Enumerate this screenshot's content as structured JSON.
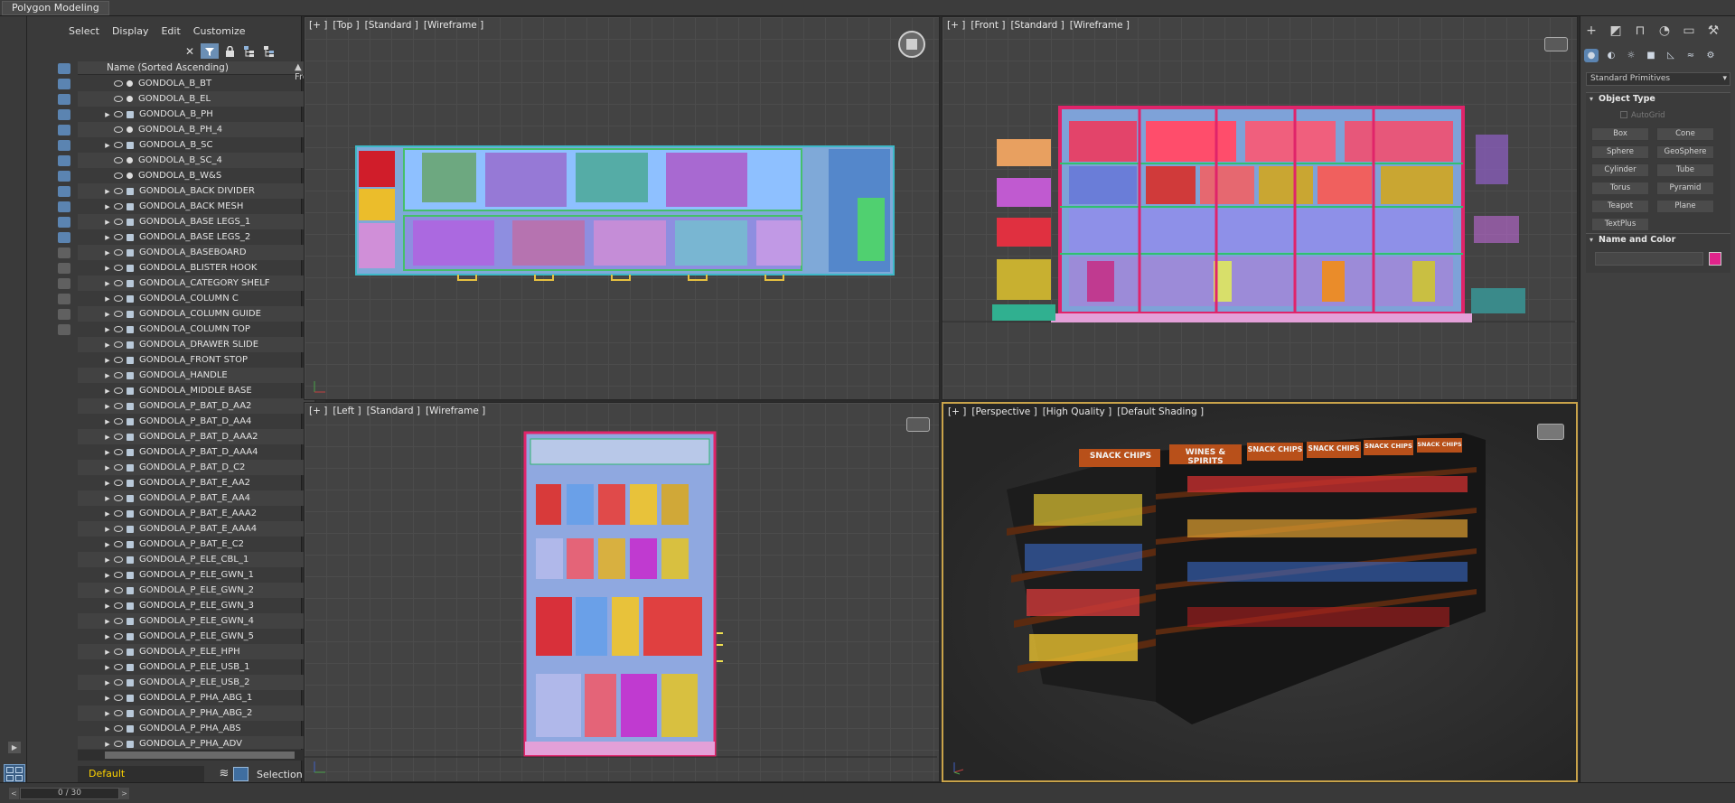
{
  "ribbon": {
    "tab": "Polygon Modeling"
  },
  "explorer": {
    "menu": [
      "Select",
      "Display",
      "Edit",
      "Customize"
    ],
    "columns": {
      "name": "Name (Sorted Ascending)",
      "frozen": "▲ Fro..."
    },
    "rows": [
      {
        "name": "GONDOLA_B_BT",
        "group": false
      },
      {
        "name": "GONDOLA_B_EL",
        "group": false
      },
      {
        "name": "GONDOLA_B_PH",
        "group": true
      },
      {
        "name": "GONDOLA_B_PH_4",
        "group": false
      },
      {
        "name": "GONDOLA_B_SC",
        "group": true
      },
      {
        "name": "GONDOLA_B_SC_4",
        "group": false
      },
      {
        "name": "GONDOLA_B_W&S",
        "group": false
      },
      {
        "name": "GONDOLA_BACK DIVIDER",
        "group": true
      },
      {
        "name": "GONDOLA_BACK MESH",
        "group": true
      },
      {
        "name": "GONDOLA_BASE LEGS_1",
        "group": true
      },
      {
        "name": "GONDOLA_BASE LEGS_2",
        "group": true
      },
      {
        "name": "GONDOLA_BASEBOARD",
        "group": true
      },
      {
        "name": "GONDOLA_BLISTER HOOK",
        "group": true
      },
      {
        "name": "GONDOLA_CATEGORY SHELF",
        "group": true
      },
      {
        "name": "GONDOLA_COLUMN C",
        "group": true
      },
      {
        "name": "GONDOLA_COLUMN GUIDE",
        "group": true
      },
      {
        "name": "GONDOLA_COLUMN TOP",
        "group": true
      },
      {
        "name": "GONDOLA_DRAWER SLIDE",
        "group": true
      },
      {
        "name": "GONDOLA_FRONT STOP",
        "group": true
      },
      {
        "name": "GONDOLA_HANDLE",
        "group": true
      },
      {
        "name": "GONDOLA_MIDDLE BASE",
        "group": true
      },
      {
        "name": "GONDOLA_P_BAT_D_AA2",
        "group": true
      },
      {
        "name": "GONDOLA_P_BAT_D_AA4",
        "group": true
      },
      {
        "name": "GONDOLA_P_BAT_D_AAA2",
        "group": true
      },
      {
        "name": "GONDOLA_P_BAT_D_AAA4",
        "group": true
      },
      {
        "name": "GONDOLA_P_BAT_D_C2",
        "group": true
      },
      {
        "name": "GONDOLA_P_BAT_E_AA2",
        "group": true
      },
      {
        "name": "GONDOLA_P_BAT_E_AA4",
        "group": true
      },
      {
        "name": "GONDOLA_P_BAT_E_AAA2",
        "group": true
      },
      {
        "name": "GONDOLA_P_BAT_E_AAA4",
        "group": true
      },
      {
        "name": "GONDOLA_P_BAT_E_C2",
        "group": true
      },
      {
        "name": "GONDOLA_P_ELE_CBL_1",
        "group": true
      },
      {
        "name": "GONDOLA_P_ELE_GWN_1",
        "group": true
      },
      {
        "name": "GONDOLA_P_ELE_GWN_2",
        "group": true
      },
      {
        "name": "GONDOLA_P_ELE_GWN_3",
        "group": true
      },
      {
        "name": "GONDOLA_P_ELE_GWN_4",
        "group": true
      },
      {
        "name": "GONDOLA_P_ELE_GWN_5",
        "group": true
      },
      {
        "name": "GONDOLA_P_ELE_HPH",
        "group": true
      },
      {
        "name": "GONDOLA_P_ELE_USB_1",
        "group": true
      },
      {
        "name": "GONDOLA_P_ELE_USB_2",
        "group": true
      },
      {
        "name": "GONDOLA_P_PHA_ABG_1",
        "group": true
      },
      {
        "name": "GONDOLA_P_PHA_ABG_2",
        "group": true
      },
      {
        "name": "GONDOLA_P_PHA_ABS",
        "group": true
      },
      {
        "name": "GONDOLA_P_PHA_ADV",
        "group": true
      }
    ],
    "layer": "Default",
    "selection_set_label": "Selection Set:"
  },
  "viewports": {
    "top": {
      "tags": [
        "[+ ]",
        "[Top ]",
        "[Standard ]",
        "[Wireframe ]"
      ]
    },
    "front": {
      "tags": [
        "[+ ]",
        "[Front ]",
        "[Standard ]",
        "[Wireframe ]"
      ]
    },
    "left": {
      "tags": [
        "[+ ]",
        "[Left ]",
        "[Standard ]",
        "[Wireframe ]"
      ]
    },
    "perspective": {
      "tags": [
        "[+ ]",
        "[Perspective ]",
        "[High Quality ]",
        "[Default Shading ]"
      ]
    }
  },
  "signs": [
    "SNACK CHIPS",
    "WINES & SPIRITS",
    "SNACK CHIPS",
    "SNACK CHIPS",
    "SNACK CHIPS",
    "SNACK CHIPS"
  ],
  "command_panel": {
    "category": "Standard Primitives",
    "object_type_title": "Object Type",
    "autogrid": "AutoGrid",
    "buttons": [
      "Box",
      "Cone",
      "Sphere",
      "GeoSphere",
      "Cylinder",
      "Tube",
      "Torus",
      "Pyramid",
      "Teapot",
      "Plane",
      "TextPlus"
    ],
    "name_color_title": "Name and Color",
    "object_color": "#e0248b"
  },
  "status": {
    "time_slider": "0 / 30",
    "prev": "<",
    "next": ">"
  },
  "colors": {
    "accent": "#5b84b1",
    "active_viewport": "#c9a34a",
    "layer_text": "#ffd400"
  }
}
